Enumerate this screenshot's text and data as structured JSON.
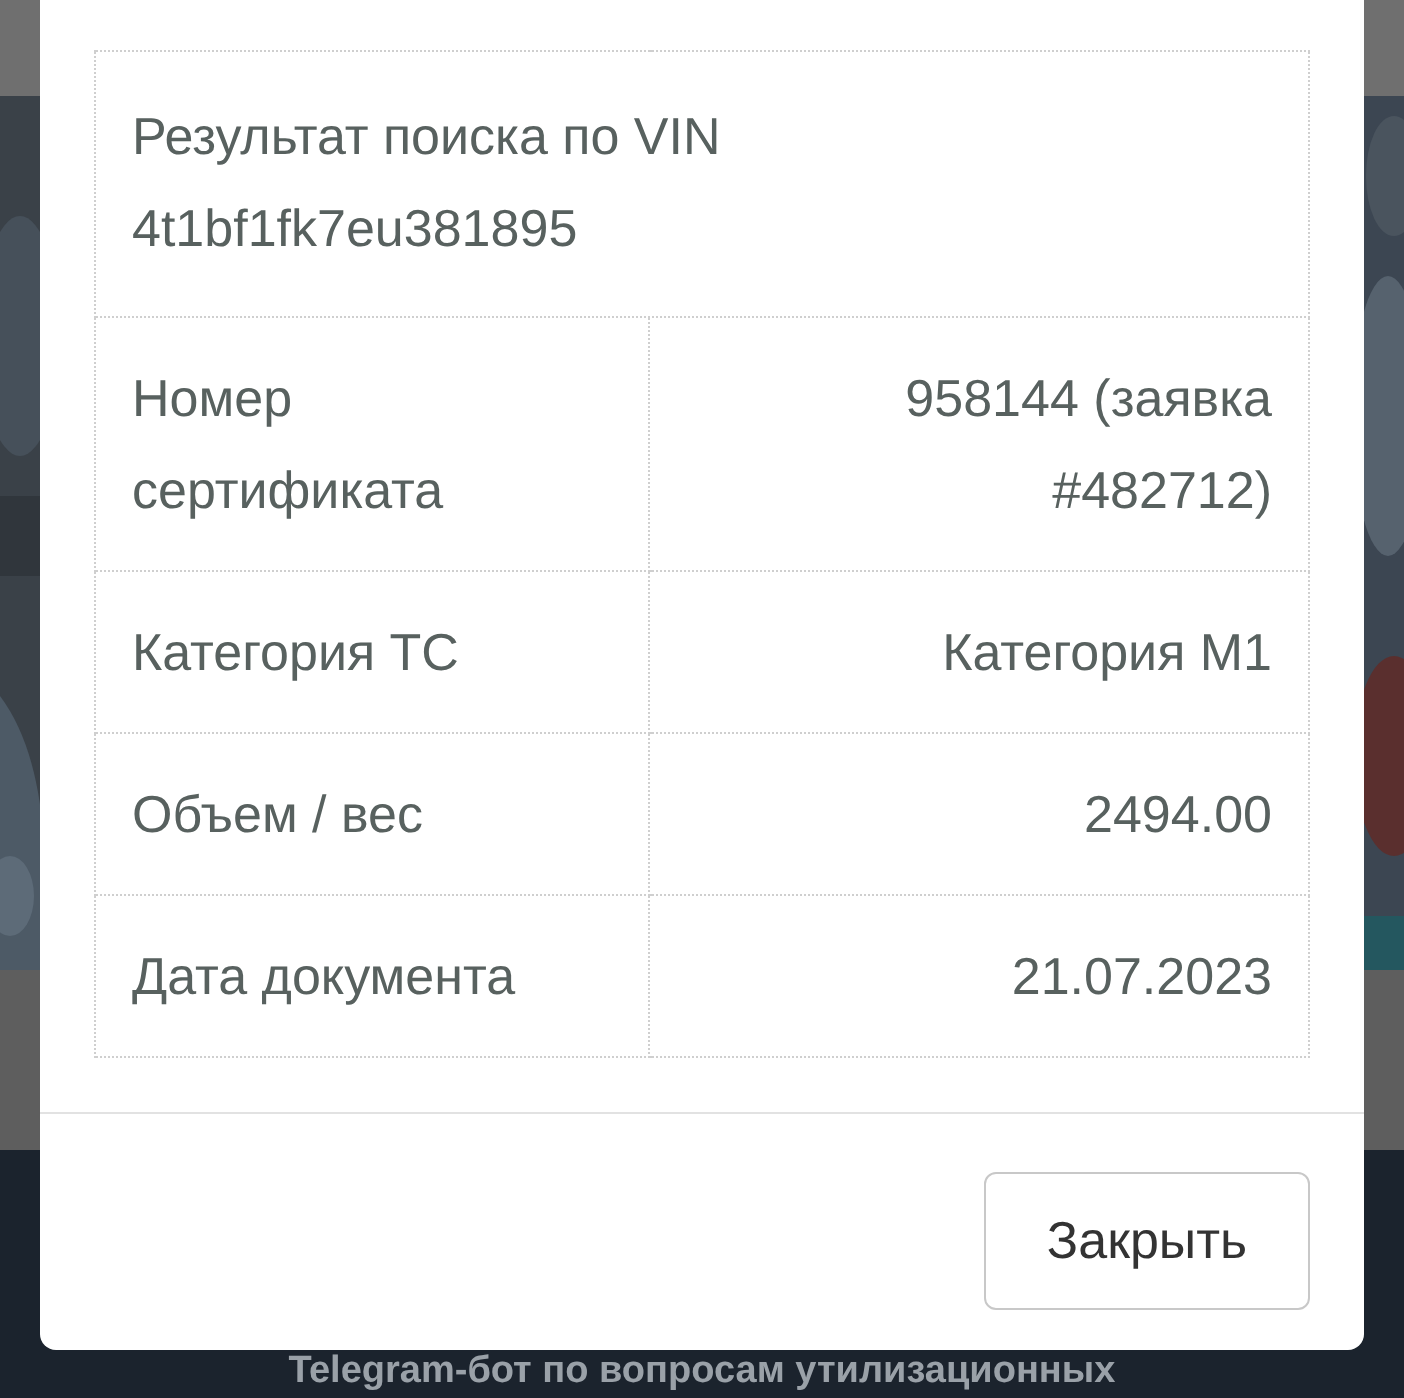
{
  "background": {
    "banner_text": "Telegram-бот по вопросам утилизационных"
  },
  "dialog": {
    "title_lines": [
      "Результат поиска по VIN",
      "4t1bf1fk7eu381895"
    ],
    "rows": [
      {
        "label": "Номер сертификата",
        "value": "958144 (заявка #482712)"
      },
      {
        "label": "Категория ТС",
        "value": "Категория M1"
      },
      {
        "label": "Объем / вес",
        "value": "2494.00"
      },
      {
        "label": "Дата документа",
        "value": "21.07.2023"
      }
    ],
    "buttons": [
      "Закрыть"
    ]
  }
}
